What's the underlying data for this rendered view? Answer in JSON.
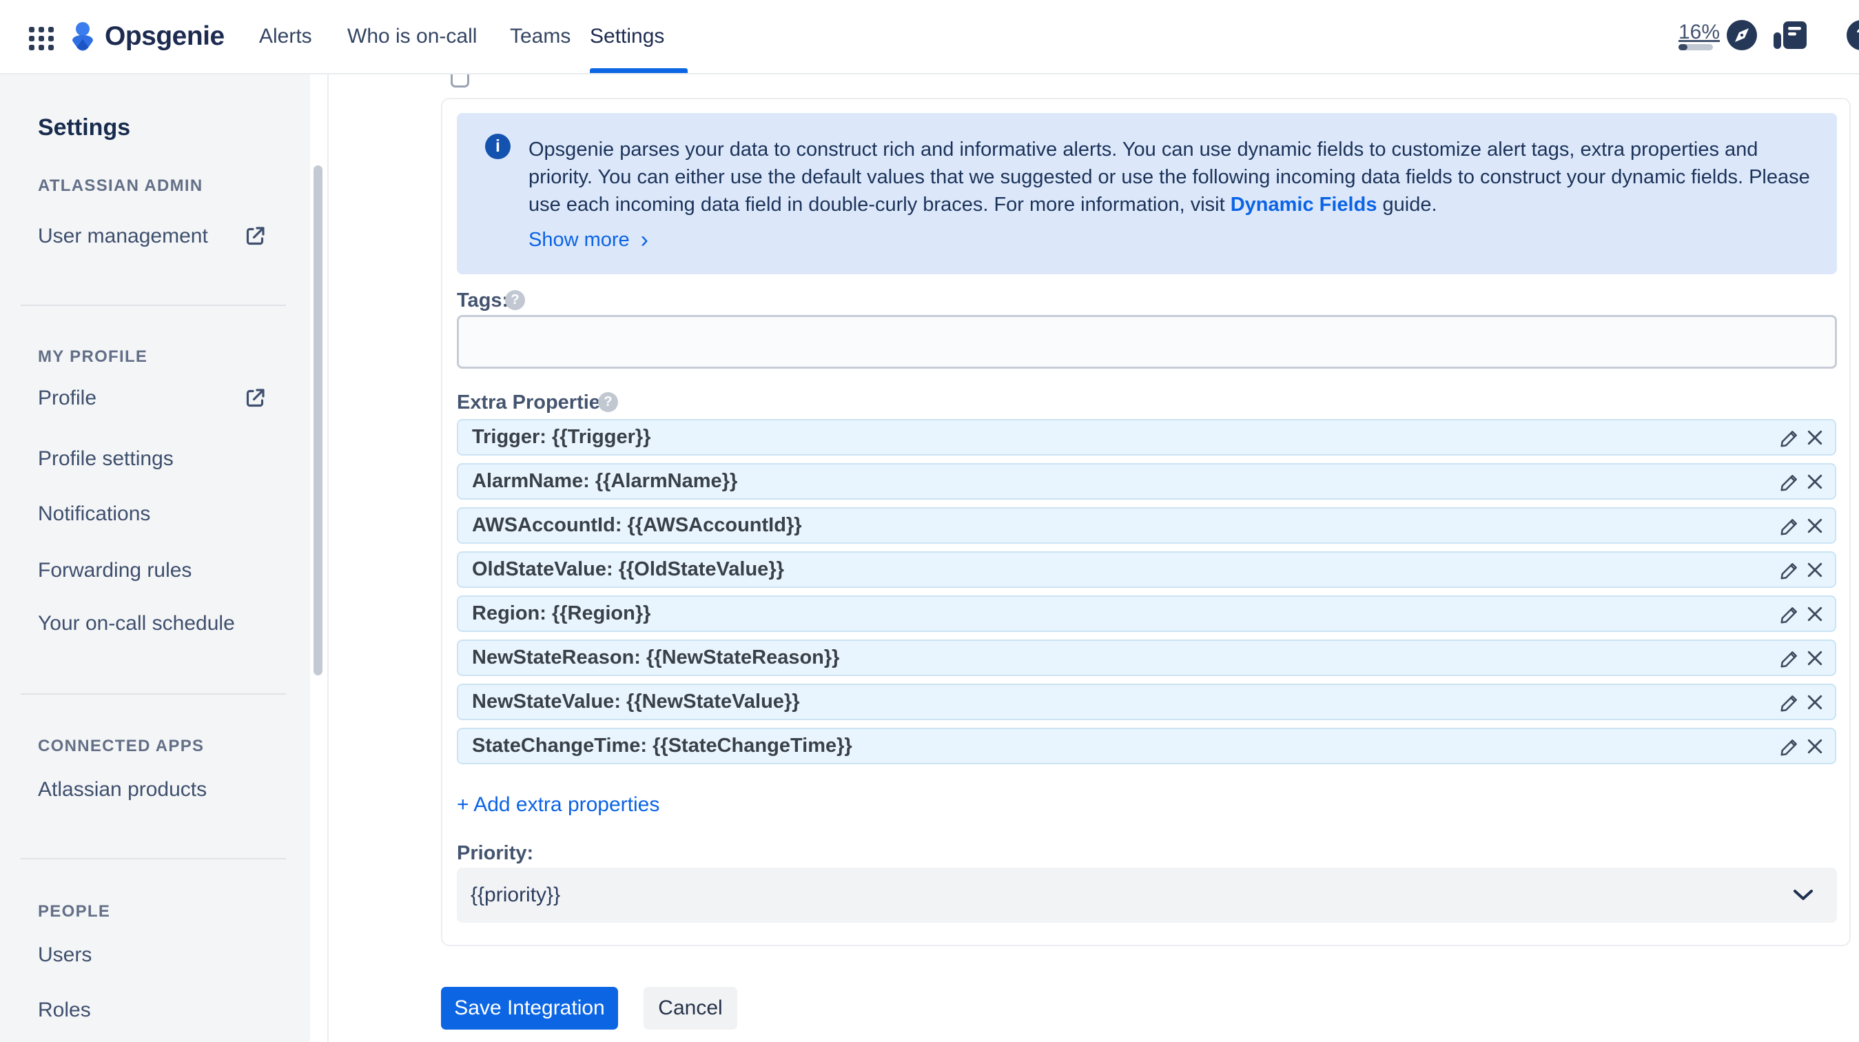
{
  "header": {
    "brand": "Opsgenie",
    "nav_items": [
      {
        "label": "Alerts"
      },
      {
        "label": "Who is on-call"
      },
      {
        "label": "Teams"
      },
      {
        "label": "Settings",
        "active": true
      }
    ],
    "trial": {
      "percent_label": "16%",
      "percent": 16
    },
    "help_avatar_glyph": "?"
  },
  "sidebar": {
    "title": "Settings",
    "sections": [
      {
        "label": "ATLASSIAN ADMIN",
        "items": [
          {
            "label": "User management",
            "external": true
          }
        ]
      },
      {
        "label": "MY PROFILE",
        "items": [
          {
            "label": "Profile",
            "external": true
          },
          {
            "label": "Profile settings"
          },
          {
            "label": "Notifications"
          },
          {
            "label": "Forwarding rules"
          },
          {
            "label": "Your on-call schedule"
          }
        ]
      },
      {
        "label": "CONNECTED APPS",
        "items": [
          {
            "label": "Atlassian products"
          }
        ]
      },
      {
        "label": "PEOPLE",
        "items": [
          {
            "label": "Users"
          },
          {
            "label": "Roles"
          }
        ]
      }
    ]
  },
  "main": {
    "info_panel": {
      "icon_glyph": "i",
      "line1": "Opsgenie parses your data to construct rich and informative alerts. You can use dynamic fields to customize alert tags, extra properties and",
      "line2": "priority. You can either use the default values that we suggested or use the following incoming data fields to construct your dynamic fields.",
      "line3_before_link": "Please use each incoming data field in double-curly braces. For more information, visit ",
      "link_label": "Dynamic Fields",
      "line3_after_link": " guide.",
      "show_more_label": "Show more",
      "show_more_chevron": "›"
    },
    "tags": {
      "label": "Tags:",
      "value": "",
      "help_glyph": "?"
    },
    "extra_properties": {
      "label": "Extra Properties:",
      "help_glyph": "?",
      "rows": [
        "Trigger: {{Trigger}}",
        "AlarmName: {{AlarmName}}",
        "AWSAccountId: {{AWSAccountId}}",
        "OldStateValue: {{OldStateValue}}",
        "Region: {{Region}}",
        "NewStateReason: {{NewStateReason}}",
        "NewStateValue: {{NewStateValue}}",
        "StateChangeTime: {{StateChangeTime}}"
      ],
      "add_label": "+ Add extra properties"
    },
    "priority": {
      "label": "Priority:",
      "value": "{{priority}}"
    },
    "actions": {
      "save_label": "Save Integration",
      "cancel_label": "Cancel"
    }
  },
  "colors": {
    "accent_blue": "#0C66E4",
    "link_blue": "#0B63E5",
    "info_panel_bg": "#DCE8FA",
    "info_icon_bg": "#1452B0",
    "property_row_bg": "#E9F5FE",
    "property_row_border": "#CBE3F3",
    "navy_icon": "#253858",
    "sidebar_bg": "#F4F5F7"
  }
}
